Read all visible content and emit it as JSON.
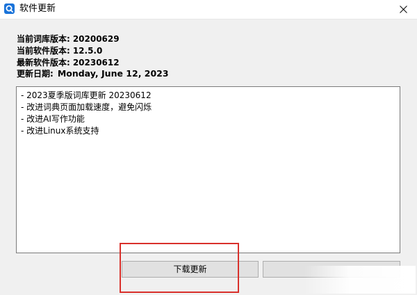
{
  "window": {
    "title": "软件更新",
    "close_glyph": "close-icon"
  },
  "info": {
    "dict_version_label": "当前词库版本:",
    "dict_version_value": "20200629",
    "app_version_label": "当前软件版本:",
    "app_version_value": "12.5.0",
    "latest_version_label": "最新软件版本:",
    "latest_version_value": "20230612",
    "update_date_label": "更新日期:",
    "update_date_value": "Monday, June 12, 2023"
  },
  "release_notes": [
    "- 2023夏季版词库更新 20230612",
    "- 改进词典页面加载速度，避免闪烁",
    "- 改进AI写作功能",
    "- 改进Linux系统支持"
  ],
  "buttons": {
    "download_update": "下载更新",
    "secondary": ""
  },
  "colors": {
    "app_icon": "#1a73d9",
    "highlight": "#d9302b",
    "button_face": "#e1e1e1"
  }
}
